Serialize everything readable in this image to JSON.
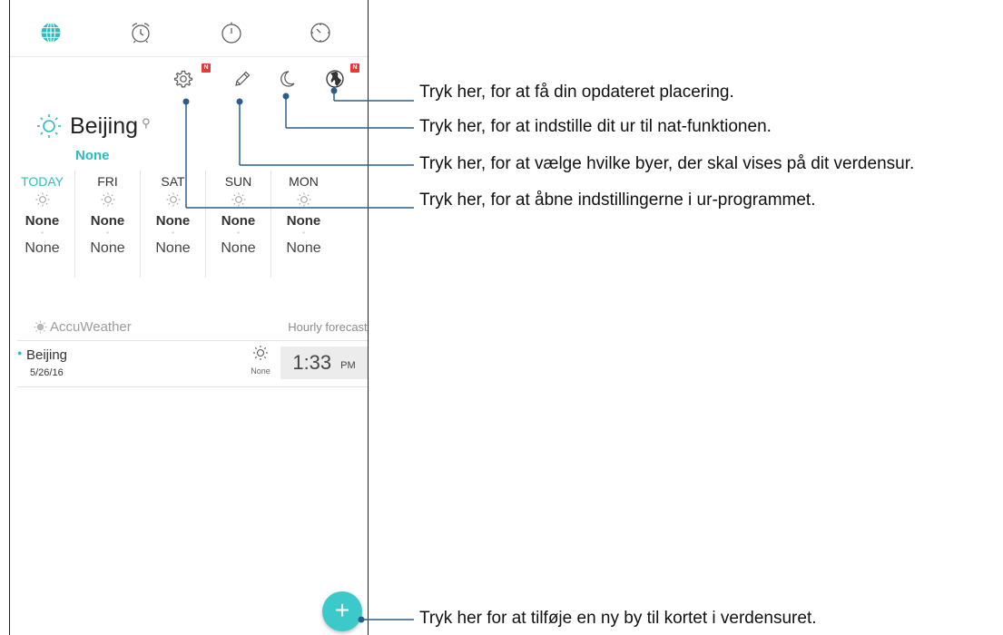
{
  "tabs": [
    {
      "name": "world-clock",
      "icon": "globe-icon",
      "active": true
    },
    {
      "name": "alarm",
      "icon": "alarm-clock-icon",
      "active": false
    },
    {
      "name": "stopwatch",
      "icon": "stopwatch-icon",
      "active": false
    },
    {
      "name": "timer",
      "icon": "timer-icon",
      "active": false
    }
  ],
  "toolbar": {
    "settings_icon": "gear-icon",
    "settings_badge": "N",
    "edit_icon": "pencil-icon",
    "night_icon": "moon-icon",
    "location_icon": "globe-location-icon",
    "location_badge": "N"
  },
  "weather": {
    "city": "Beijing",
    "condition": "None",
    "icon": "sun-icon",
    "accent_color": "#2bbdc0",
    "forecast": [
      {
        "day": "TODAY",
        "high": "None",
        "low": "None"
      },
      {
        "day": "FRI",
        "high": "None",
        "low": "None"
      },
      {
        "day": "SAT",
        "high": "None",
        "low": "None"
      },
      {
        "day": "SUN",
        "high": "None",
        "low": "None"
      },
      {
        "day": "MON",
        "high": "None",
        "low": "None"
      }
    ]
  },
  "accuweather": {
    "brand": "AccuWeather",
    "hourly_label": "Hourly forecast",
    "hourly_chevron": "›"
  },
  "world_clock": {
    "city": "Beijing",
    "date": "5/26/16",
    "condition": "None",
    "time": "1:33",
    "ampm": "PM"
  },
  "fab": {
    "symbol": "+",
    "icon": "plus-icon",
    "color": "#3cc9c9"
  },
  "callouts": {
    "location": "Tryk her, for at få din opdateret placering.",
    "night": "Tryk her, for at indstille dit ur til nat-funktionen.",
    "edit": "Tryk her, for at vælge hvilke byer, der skal vises på dit verdensur.",
    "settings": "Tryk her, for at åbne indstillingerne i ur-programmet.",
    "add_city": "Tryk her for at tilføje en ny by til kortet i verdensuret."
  }
}
